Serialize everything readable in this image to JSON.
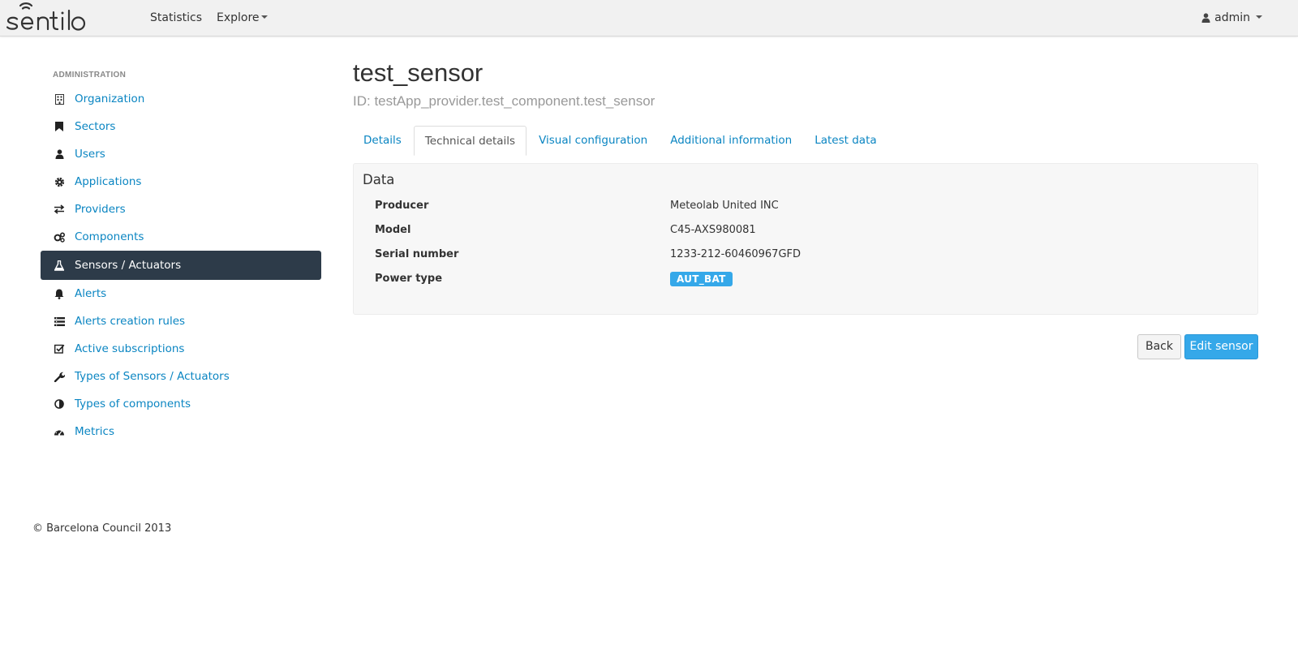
{
  "navbar": {
    "brand": "sentilo",
    "links": [
      "Statistics",
      "Explore"
    ],
    "user": "admin"
  },
  "sidebar": {
    "header": "ADMINISTRATION",
    "items": [
      {
        "label": "Organization",
        "icon": "building-icon"
      },
      {
        "label": "Sectors",
        "icon": "bookmark-icon"
      },
      {
        "label": "Users",
        "icon": "user-icon"
      },
      {
        "label": "Applications",
        "icon": "gear-icon"
      },
      {
        "label": "Providers",
        "icon": "exchange-icon"
      },
      {
        "label": "Components",
        "icon": "gears-icon"
      },
      {
        "label": "Sensors / Actuators",
        "icon": "flask-icon",
        "active": true
      },
      {
        "label": "Alerts",
        "icon": "bell-icon"
      },
      {
        "label": "Alerts creation rules",
        "icon": "list-icon"
      },
      {
        "label": "Active subscriptions",
        "icon": "check-square-icon"
      },
      {
        "label": "Types of Sensors / Actuators",
        "icon": "wrench-icon"
      },
      {
        "label": "Types of components",
        "icon": "half-circle-icon"
      },
      {
        "label": "Metrics",
        "icon": "dashboard-icon"
      }
    ]
  },
  "main": {
    "title": "test_sensor",
    "subtitle": "ID: testApp_provider.test_component.test_sensor",
    "tabs": [
      "Details",
      "Technical details",
      "Visual configuration",
      "Additional information",
      "Latest data"
    ],
    "active_tab": "Technical details",
    "panel": {
      "title": "Data",
      "rows": [
        {
          "label": "Producer",
          "value": "Meteolab United INC"
        },
        {
          "label": "Model",
          "value": "C45-AXS980081"
        },
        {
          "label": "Serial number",
          "value": "1233-212-60460967GFD"
        },
        {
          "label": "Power type",
          "value": "AUT_BAT"
        }
      ]
    },
    "buttons": {
      "back": "Back",
      "edit": "Edit sensor"
    }
  },
  "footer": "© Barcelona Council 2013",
  "colors": {
    "link": "#0a85c2",
    "sidebar_active": "#2d3b49",
    "primary": "#35a8e9"
  }
}
